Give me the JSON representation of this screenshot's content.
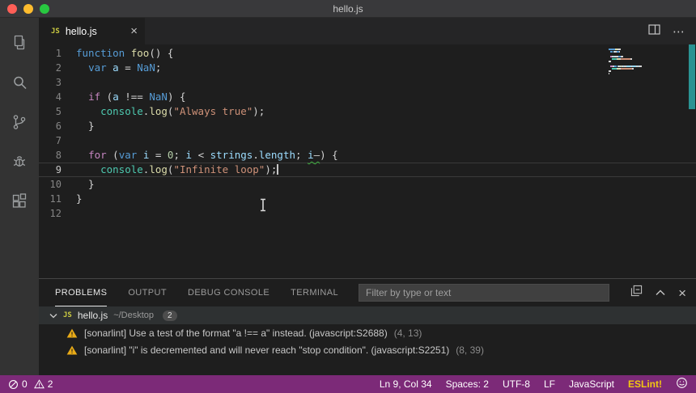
{
  "window": {
    "title": "hello.js"
  },
  "activity_bar": {
    "icons": [
      "explorer-icon",
      "search-icon",
      "source-control-icon",
      "debug-icon",
      "extensions-icon"
    ]
  },
  "tab": {
    "label": "hello.js",
    "file_icon": "JS",
    "close": "×"
  },
  "tabbar_actions": {
    "more": "⋯"
  },
  "editor": {
    "current_line": 9,
    "cursor": {
      "line": 9,
      "col": 34
    },
    "lines": [
      {
        "num": 1,
        "segments": [
          {
            "t": "function ",
            "c": "k"
          },
          {
            "t": "foo",
            "c": "f"
          },
          {
            "t": "() {",
            "c": "p"
          }
        ]
      },
      {
        "num": 2,
        "segments": [
          {
            "t": "  ",
            "c": "p"
          },
          {
            "t": "var",
            "c": "k"
          },
          {
            "t": " ",
            "c": "p"
          },
          {
            "t": "a",
            "c": "v"
          },
          {
            "t": " = ",
            "c": "p"
          },
          {
            "t": "NaN",
            "c": "k"
          },
          {
            "t": ";",
            "c": "p"
          }
        ]
      },
      {
        "num": 3,
        "segments": []
      },
      {
        "num": 4,
        "segments": [
          {
            "t": "  ",
            "c": "p"
          },
          {
            "t": "if",
            "c": "c"
          },
          {
            "t": " (",
            "c": "p"
          },
          {
            "t": "a",
            "c": "v"
          },
          {
            "t": " !== ",
            "c": "p"
          },
          {
            "t": "NaN",
            "c": "k"
          },
          {
            "t": ") {",
            "c": "p"
          }
        ]
      },
      {
        "num": 5,
        "segments": [
          {
            "t": "    ",
            "c": "p"
          },
          {
            "t": "console",
            "c": "t"
          },
          {
            "t": ".",
            "c": "p"
          },
          {
            "t": "log",
            "c": "f"
          },
          {
            "t": "(",
            "c": "p"
          },
          {
            "t": "\"Always true\"",
            "c": "s"
          },
          {
            "t": ");",
            "c": "p"
          }
        ]
      },
      {
        "num": 6,
        "segments": [
          {
            "t": "  }",
            "c": "p"
          }
        ]
      },
      {
        "num": 7,
        "segments": []
      },
      {
        "num": 8,
        "segments": [
          {
            "t": "  ",
            "c": "p"
          },
          {
            "t": "for",
            "c": "c"
          },
          {
            "t": " (",
            "c": "p"
          },
          {
            "t": "var",
            "c": "k"
          },
          {
            "t": " ",
            "c": "p"
          },
          {
            "t": "i",
            "c": "v"
          },
          {
            "t": " = ",
            "c": "p"
          },
          {
            "t": "0",
            "c": "n"
          },
          {
            "t": "; ",
            "c": "p"
          },
          {
            "t": "i",
            "c": "v"
          },
          {
            "t": " < ",
            "c": "p"
          },
          {
            "t": "strings",
            "c": "v"
          },
          {
            "t": ".",
            "c": "p"
          },
          {
            "t": "length",
            "c": "v"
          },
          {
            "t": "; ",
            "c": "p"
          },
          {
            "t": "i",
            "c": "v",
            "u": true
          },
          {
            "t": "—",
            "c": "p",
            "u": true
          },
          {
            "t": ") {",
            "c": "p"
          }
        ]
      },
      {
        "num": 9,
        "segments": [
          {
            "t": "    ",
            "c": "p"
          },
          {
            "t": "console",
            "c": "t"
          },
          {
            "t": ".",
            "c": "p"
          },
          {
            "t": "log",
            "c": "f"
          },
          {
            "t": "(",
            "c": "p"
          },
          {
            "t": "\"Infinite loop\"",
            "c": "s"
          },
          {
            "t": ");",
            "c": "p"
          }
        ]
      },
      {
        "num": 10,
        "segments": [
          {
            "t": "  }",
            "c": "p"
          }
        ]
      },
      {
        "num": 11,
        "segments": [
          {
            "t": "}",
            "c": "p"
          }
        ]
      },
      {
        "num": 12,
        "segments": []
      }
    ]
  },
  "panel": {
    "tabs": [
      "PROBLEMS",
      "OUTPUT",
      "DEBUG CONSOLE",
      "TERMINAL"
    ],
    "active_tab": "PROBLEMS",
    "filter_placeholder": "Filter by type or text"
  },
  "problems": {
    "group": {
      "file": "hello.js",
      "path": "~/Desktop",
      "count": "2",
      "file_icon": "JS"
    },
    "items": [
      {
        "severity": "warning",
        "message": "[sonarlint] Use a test of the format \"a !== a\" instead. (javascript:S2688)",
        "location": "(4, 13)"
      },
      {
        "severity": "warning",
        "message": "[sonarlint] \"i\" is decremented and will never reach \"stop condition\". (javascript:S2251)",
        "location": "(8, 39)"
      }
    ]
  },
  "status_bar": {
    "errors": "0",
    "warnings": "2",
    "line_col": "Ln 9, Col 34",
    "indentation": "Spaces: 2",
    "encoding": "UTF-8",
    "eol": "LF",
    "language": "JavaScript",
    "eslint": "ESLint!"
  },
  "colors": {
    "statusbar-bg": "#7c2a78",
    "warning-yellow": "#e9ab17",
    "squiggle-green": "#3fae3f",
    "eslint-yellow": "#f2c811",
    "scrollbar-teal": "#2da8a8",
    "js-icon-yellow": "#cbcb41"
  }
}
